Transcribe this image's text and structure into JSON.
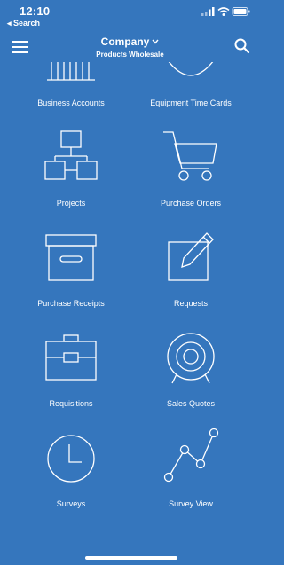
{
  "status_bar": {
    "time": "12:10",
    "back_label": "◂ Search",
    "icons": [
      "signal-icon",
      "wifi-icon",
      "battery-icon"
    ]
  },
  "nav": {
    "menu_icon": "hamburger-menu-icon",
    "title": "Company",
    "title_dropdown_icon": "chevron-down-icon",
    "subtitle": "Products Wholesale",
    "search_icon": "search-icon"
  },
  "tiles": [
    {
      "label": "Business Accounts",
      "icon": "business-accounts-icon"
    },
    {
      "label": "Equipment Time Cards",
      "icon": "equipment-time-cards-icon"
    },
    {
      "label": "Projects",
      "icon": "org-chart-icon"
    },
    {
      "label": "Purchase Orders",
      "icon": "shopping-cart-icon"
    },
    {
      "label": "Purchase Receipts",
      "icon": "archive-box-icon"
    },
    {
      "label": "Requests",
      "icon": "pencil-note-icon"
    },
    {
      "label": "Requisitions",
      "icon": "briefcase-icon"
    },
    {
      "label": "Sales Quotes",
      "icon": "target-icon"
    },
    {
      "label": "Surveys",
      "icon": "clock-icon"
    },
    {
      "label": "Survey View",
      "icon": "line-chart-icon"
    }
  ],
  "colors": {
    "background": "#3576bd",
    "foreground": "#ffffff"
  }
}
